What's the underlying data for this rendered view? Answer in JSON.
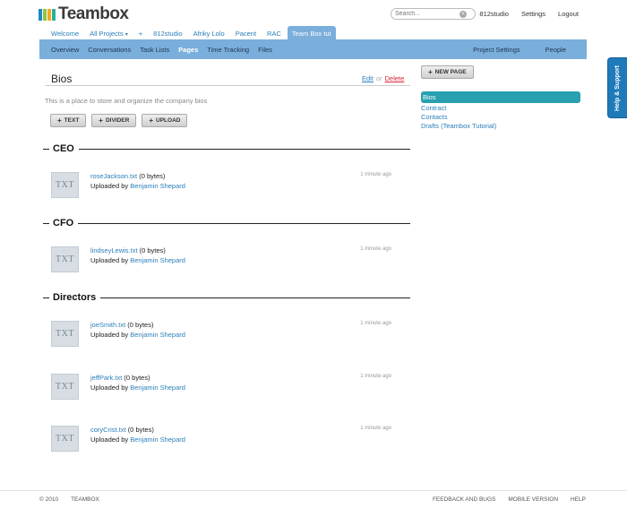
{
  "brand": {
    "name": "Teambox",
    "colors": [
      "#1e88c8",
      "#8cc63f",
      "#f5a623",
      "#2bb0a0"
    ]
  },
  "search": {
    "placeholder": "Search...",
    "clear_icon": "clear-icon"
  },
  "top_links": {
    "org": "812studio",
    "settings": "Settings",
    "logout": "Logout"
  },
  "project_tabs": [
    {
      "label": "Welcome"
    },
    {
      "label": "All Projects",
      "caret": "▾"
    },
    {
      "label": "+"
    },
    {
      "label": "812studio"
    },
    {
      "label": "Afriky Lolo"
    },
    {
      "label": "Pacent"
    },
    {
      "label": "RAC"
    },
    {
      "label": "Team Box tut",
      "active": true
    }
  ],
  "nav": {
    "left": [
      "Overview",
      "Conversations",
      "Task Lists",
      "Pages",
      "Time Tracking",
      "Files"
    ],
    "active": "Pages",
    "right": [
      "Project Settings",
      "People"
    ]
  },
  "page": {
    "title": "Bios",
    "edit": "Edit",
    "or": "or",
    "delete": "Delete",
    "description": "This is a place to store and organize the company bios",
    "buttons": {
      "text": "TEXT",
      "divider": "DIVIDER",
      "upload": "UPLOAD"
    }
  },
  "sections": {
    "ceo": "CEO",
    "cfo": "CFO",
    "directors": "Directors"
  },
  "files": [
    {
      "name": "roseJackson.txt",
      "size": "(0 bytes)",
      "uploaded_by": "Uploaded by",
      "user": "Benjamin Shepard",
      "time": "1 minute ago",
      "thumb": "TXT"
    },
    {
      "name": "lindseyLewis.txt",
      "size": "(0 bytes)",
      "uploaded_by": "Uploaded by",
      "user": "Benjamin Shepard",
      "time": "1 minute ago",
      "thumb": "TXT"
    },
    {
      "name": "joeSmith.txt",
      "size": "(0 bytes)",
      "uploaded_by": "Uploaded by",
      "user": "Benjamin Shepard",
      "time": "1 minute ago",
      "thumb": "TXT"
    },
    {
      "name": "jeffPark.txt",
      "size": "(0 bytes)",
      "uploaded_by": "Uploaded by",
      "user": "Benjamin Shepard",
      "time": "1 minute ago",
      "thumb": "TXT"
    },
    {
      "name": "coryCrist.txt",
      "size": "(0 bytes)",
      "uploaded_by": "Uploaded by",
      "user": "Benjamin Shepard",
      "time": "1 minute ago",
      "thumb": "TXT"
    }
  ],
  "sidebar": {
    "new_page": "NEW PAGE",
    "pages": [
      "Bios",
      "Contract",
      "Contacts",
      "Drafts (Teambox Tutorial)"
    ],
    "active": "Bios"
  },
  "help_tab": "Help & Support",
  "footer": {
    "copyright": "© 2010",
    "brand": "TEAMBOX",
    "feedback": "FEEDBACK AND BUGS",
    "mobile": "MOBILE VERSION",
    "help": "HELP"
  }
}
